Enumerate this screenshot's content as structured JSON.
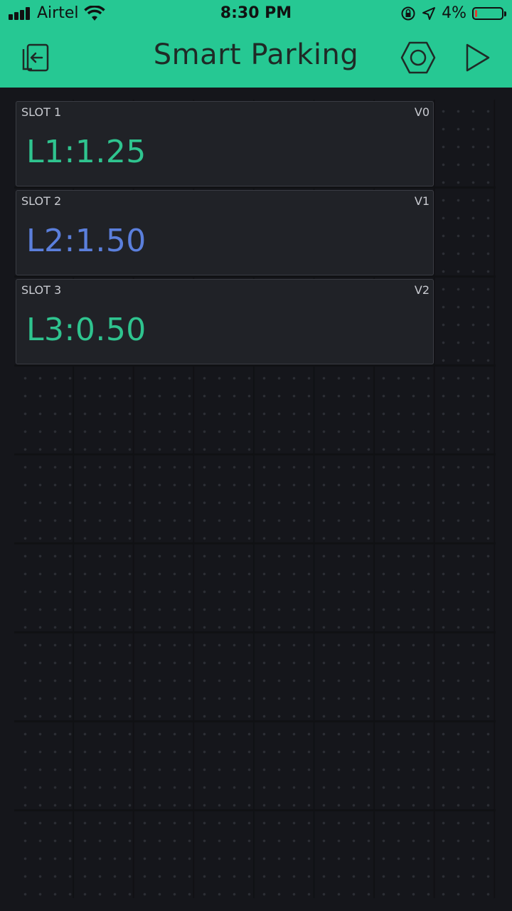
{
  "status_bar": {
    "carrier": "Airtel",
    "time": "8:30 PM",
    "battery_percent": "4%",
    "battery_level": 0.04
  },
  "header": {
    "title": "Smart Parking",
    "back_icon": "exit-project-icon",
    "settings_icon": "hexagon-settings-icon",
    "play_icon": "play-icon"
  },
  "widgets": [
    {
      "label": "SLOT 1",
      "pin": "V0",
      "value": "L1:1.25",
      "color": "#2fc48f"
    },
    {
      "label": "SLOT 2",
      "pin": "V1",
      "value": "L2:1.50",
      "color": "#5b7fdc"
    },
    {
      "label": "SLOT 3",
      "pin": "V2",
      "value": "L3:0.50",
      "color": "#2fc48f"
    }
  ],
  "colors": {
    "accent": "#26c893",
    "background": "#15161b",
    "widget_bg": "#202227"
  }
}
